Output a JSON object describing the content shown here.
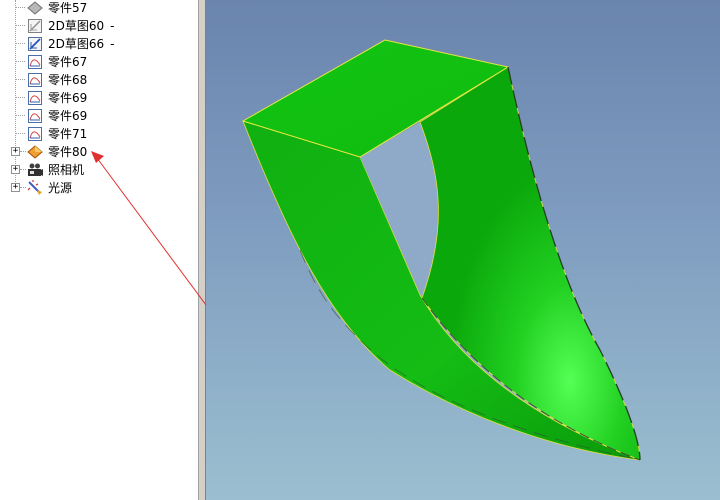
{
  "tree": {
    "items": [
      {
        "label": "零件57",
        "suffix": "",
        "icon": "part-icon",
        "expandable": false
      },
      {
        "label": "2D草图60",
        "suffix": "-",
        "icon": "sketch-icon",
        "expandable": false
      },
      {
        "label": "2D草图66",
        "suffix": "-",
        "icon": "sketch-edit-icon",
        "expandable": false
      },
      {
        "label": "零件67",
        "suffix": "",
        "icon": "surface-part-icon",
        "expandable": false
      },
      {
        "label": "零件68",
        "suffix": "",
        "icon": "surface-part-icon",
        "expandable": false
      },
      {
        "label": "零件69",
        "suffix": "",
        "icon": "surface-part-icon",
        "expandable": false
      },
      {
        "label": "零件69",
        "suffix": "",
        "icon": "surface-part-icon",
        "expandable": false
      },
      {
        "label": "零件71",
        "suffix": "",
        "icon": "surface-part-icon",
        "expandable": false
      },
      {
        "label": "零件80",
        "suffix": "",
        "icon": "solid-part-icon",
        "expandable": true
      },
      {
        "label": "照相机",
        "suffix": "",
        "icon": "camera-icon",
        "expandable": true
      },
      {
        "label": "光源",
        "suffix": "",
        "icon": "light-source-icon",
        "expandable": true
      }
    ],
    "expander_symbol": "+"
  },
  "colors": {
    "model_green": "#0fbf0f",
    "model_edge": "#e0e040",
    "annotation_arrow": "#e03030",
    "viewport_top": "#6a84ad",
    "viewport_bottom": "#9bbfd0"
  }
}
